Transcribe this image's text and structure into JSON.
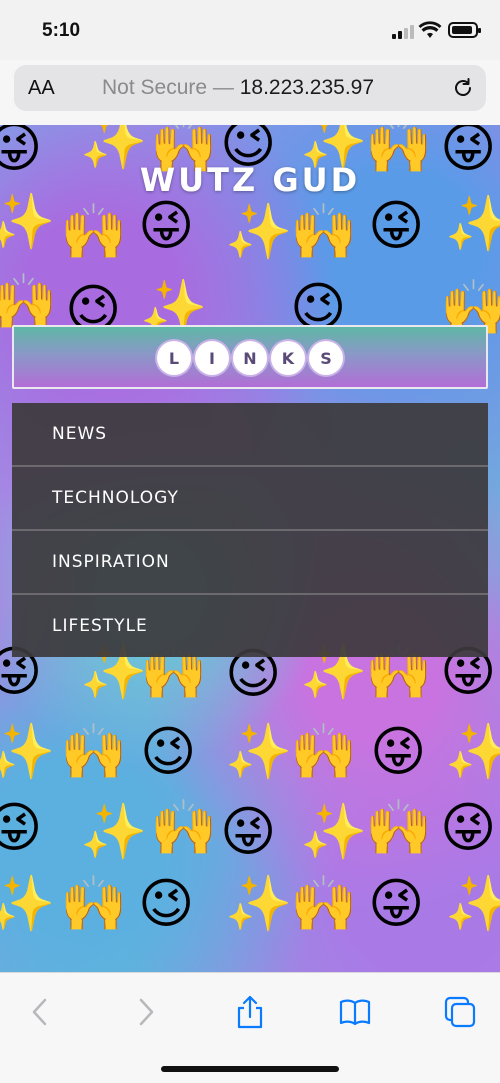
{
  "status_bar": {
    "time": "5:10"
  },
  "address_bar": {
    "text_size_label": "AA",
    "security": "Not Secure —",
    "host": "18.223.235.97"
  },
  "site": {
    "logo": "WUTZ GUD",
    "links_header_letters": [
      "L",
      "I",
      "N",
      "K",
      "S"
    ],
    "menu_items": [
      "NEWS",
      "TECHNOLOGY",
      "INSPIRATION",
      "LIFESTYLE"
    ]
  },
  "toolbar": {
    "back_icon": "chevron-left-icon",
    "forward_icon": "chevron-right-icon",
    "share_icon": "share-icon",
    "bookmarks_icon": "book-icon",
    "tabs_icon": "tabs-icon"
  },
  "colors": {
    "accent": "#0a7aff",
    "menu_bg": "#3c3a3c"
  }
}
